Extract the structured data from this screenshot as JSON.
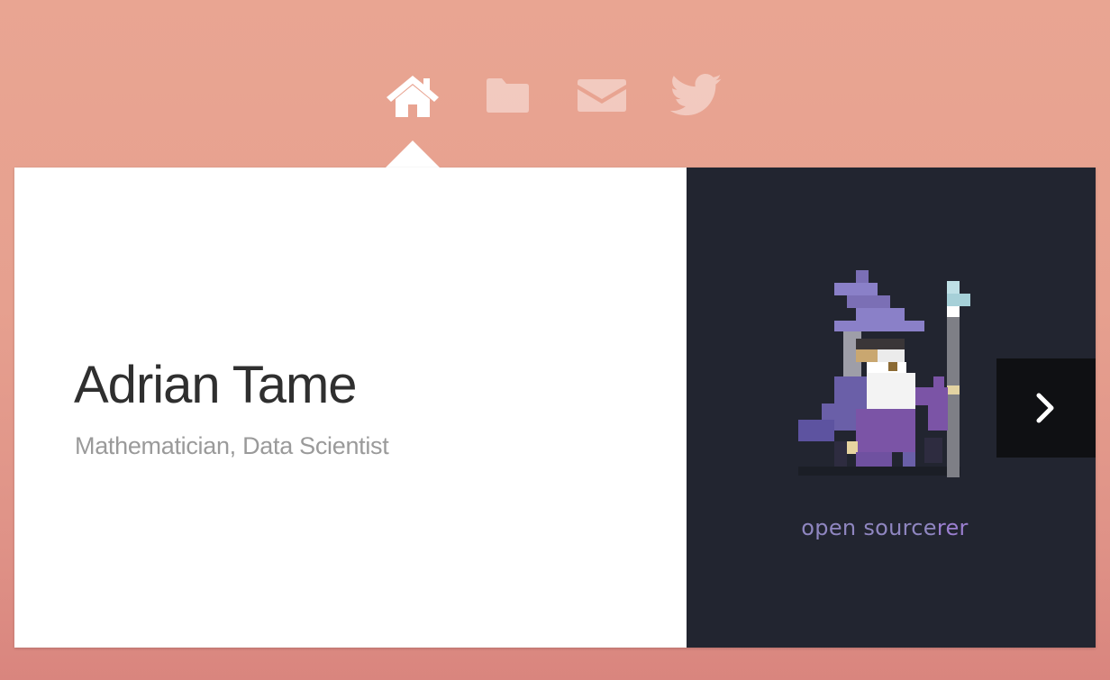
{
  "nav": {
    "items": [
      {
        "icon": "home-icon",
        "active": true
      },
      {
        "icon": "folder-icon",
        "active": false
      },
      {
        "icon": "mail-icon",
        "active": false
      },
      {
        "icon": "twitter-icon",
        "active": false
      }
    ]
  },
  "profile": {
    "name": "Adrian Tame",
    "subtitle": "Mathematician, Data Scientist"
  },
  "slide": {
    "caption_prefix": "open source",
    "caption_suffix": "rer",
    "next_icon": "chevron-right-icon"
  },
  "colors": {
    "background": "#e6a08f",
    "card": "#ffffff",
    "dark_panel": "#222530",
    "next_button": "#0f1013",
    "caption": "#8f86c0"
  }
}
